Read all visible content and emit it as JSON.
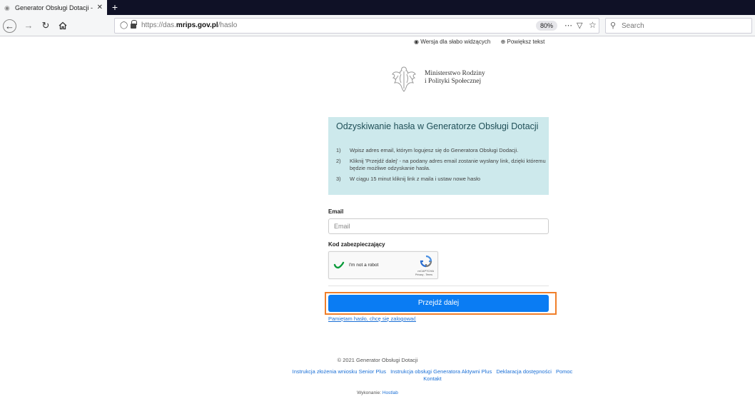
{
  "browser": {
    "tab_title": "Generator Obsługi Dotacji - Od",
    "url_prefix": "https://das.",
    "url_domain": "mrips.gov.pl",
    "url_path": "/haslo",
    "zoom": "80%",
    "search_placeholder": "Search",
    "icons": [
      "back-icon",
      "forward-icon",
      "reload-icon",
      "home-icon",
      "shield-icon",
      "lock-icon",
      "more-icon",
      "pocket-icon",
      "bookmark-star-icon",
      "search-icon"
    ]
  },
  "accessibility": {
    "contrast_label": "Wersja dla słabo widzących",
    "enlarge_label": "Powiększ tekst"
  },
  "header": {
    "ministry_line1": "Ministerstwo Rodziny",
    "ministry_line2": "i Polityki Społecznej"
  },
  "info": {
    "title": "Odzyskiwanie hasła w Generatorze Obsługi Dotacji",
    "steps": [
      {
        "num": "1)",
        "text": "Wpisz adres email, którym logujesz się do Generatora Obsługi Dodacji."
      },
      {
        "num": "2)",
        "text": "Kliknij 'Przejdź dalej' - na podany adres email zostanie wysłany link, dzięki któremu będzie możliwe odzyskanie hasła."
      },
      {
        "num": "3)",
        "text": "W ciągu 15 minut kliknij link z maila i ustaw nowe hasło"
      }
    ]
  },
  "form": {
    "email_label": "Email",
    "email_placeholder": "Email",
    "captcha_label": "Kod zabezpieczający",
    "recaptcha_text": "I'm not a robot",
    "recaptcha_brand": "reCAPTCHA",
    "recaptcha_terms": "Privacy - Terms",
    "submit_label": "Przejdź dalej",
    "remember_link": "Pamiętam hasło, chcę się zalogować"
  },
  "footer": {
    "copyright": "© 2021 Generator Obsługi Dotacji",
    "links": [
      "Instrukcja złożenia wniosku Senior Plus",
      "Instrukcja obsługi Generatora Aktywni Plus",
      "Deklaracja dostępności",
      "Pomoc",
      "Kontakt"
    ],
    "made_by_label": "Wykonanie:",
    "made_by_link": "Hostlab"
  },
  "colors": {
    "info_bg": "#cde9ec",
    "submit_bg": "#0a7cf3",
    "highlight_border": "#f07f2a",
    "link": "#1a6fd6"
  }
}
